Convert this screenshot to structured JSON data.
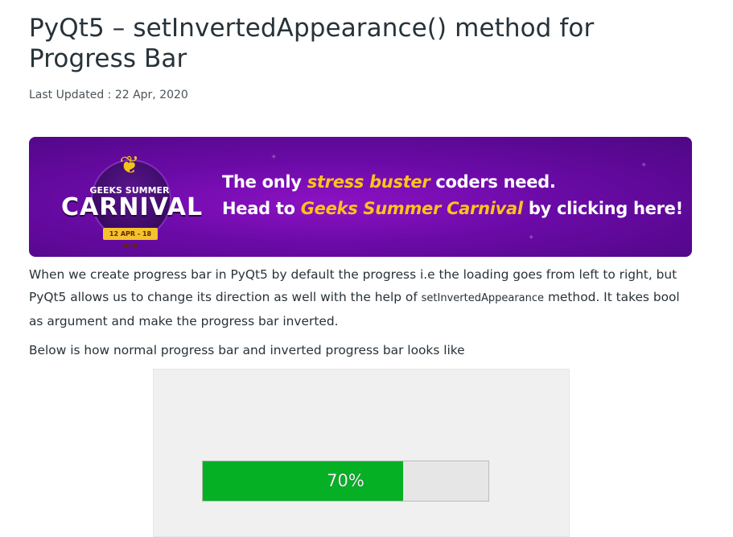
{
  "article": {
    "title": "PyQt5 – setInvertedAppearance() method for Progress Bar",
    "last_updated": "Last Updated : 22 Apr, 2020"
  },
  "banner": {
    "badge_small": "GEEKS SUMMER",
    "badge_big": "CARNIVAL",
    "badge_dates": "12 APR - 18 APR",
    "line1_a": "The only ",
    "line1_highlight": "stress buster",
    "line1_b": " coders need.",
    "line2_a": "Head to ",
    "line2_highlight": "Geeks Summer Carnival",
    "line2_b": " by clicking here!",
    "background_color": "#6a0aa6",
    "highlight_color": "#ffc21c"
  },
  "paragraphs": {
    "p1_before_code": "When we create progress bar in PyQt5 by default the progress i.e the loading goes from left to right, but PyQt5 allows us to change its direction as well with the help of ",
    "p1_code": "setInvertedAppearance",
    "p1_after_code": " method. It takes bool as argument and make the progress bar inverted.",
    "p2": "Below is how normal progress bar and inverted progress bar looks like"
  },
  "example_image": {
    "progress_text": "70%",
    "progress_value": 0.7,
    "fill_color": "#06b025"
  }
}
